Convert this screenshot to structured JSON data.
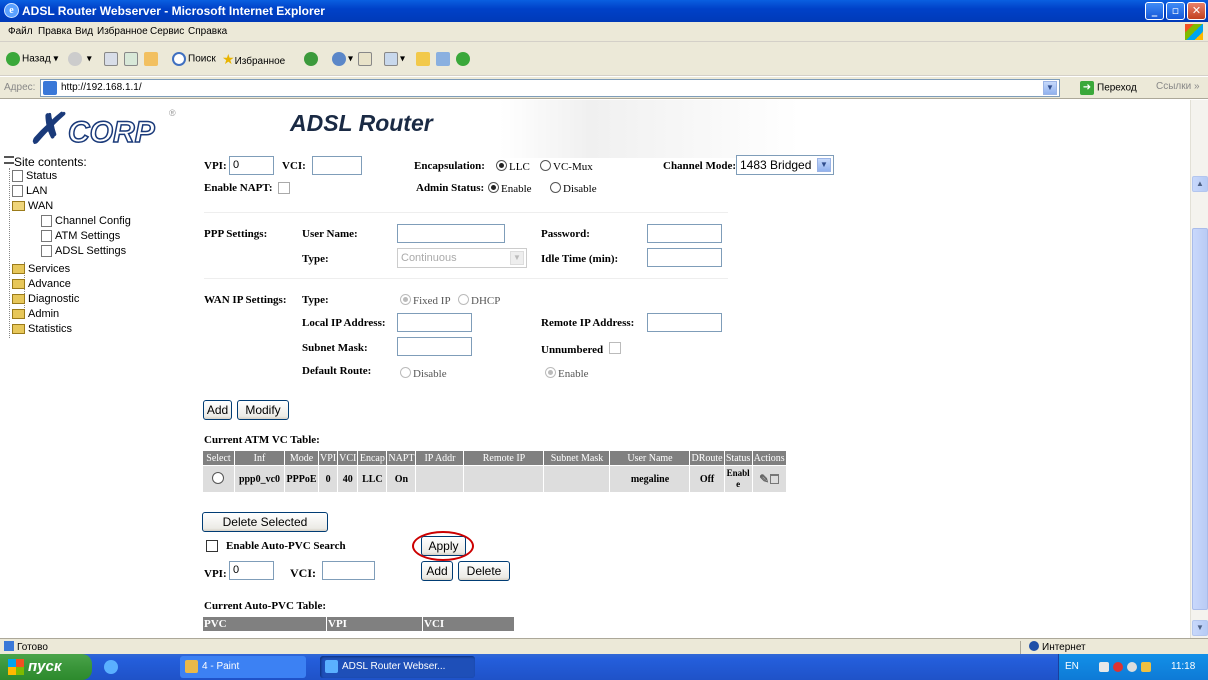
{
  "window": {
    "title": "ADSL Router Webserver - Microsoft Internet Explorer"
  },
  "menu": [
    "Файл",
    "Правка",
    "Вид",
    "Избранное",
    "Сервис",
    "Справка"
  ],
  "toolbar": {
    "back": "Назад",
    "search": "Поиск",
    "favorites": "Избранное"
  },
  "address": {
    "label": "Адрес:",
    "url": "http://192.168.1.1/",
    "go": "Переход",
    "links": "Ссылки"
  },
  "page": {
    "brand": "CORP",
    "heading": "ADSL Router",
    "sidebar": {
      "title": "Site contents:",
      "items": [
        "Status",
        "LAN",
        "WAN",
        "Channel Config",
        "ATM Settings",
        "ADSL Settings",
        "Services",
        "Advance",
        "Diagnostic",
        "Admin",
        "Statistics"
      ]
    },
    "form": {
      "vpi_label": "VPI:",
      "vpi": "0",
      "vci_label": "VCI:",
      "vci": "",
      "encap_label": "Encapsulation:",
      "encap_llc": "LLC",
      "encap_vcmux": "VC-Mux",
      "channel_mode_label": "Channel Mode:",
      "channel_mode": "1483 Bridged",
      "napt_label": "Enable NAPT:",
      "admin_label": "Admin Status:",
      "admin_enable": "Enable",
      "admin_disable": "Disable",
      "ppp_label": "PPP Settings:",
      "username_label": "User Name:",
      "password_label": "Password:",
      "type_label": "Type:",
      "type_value": "Continuous",
      "idle_label": "Idle Time (min):",
      "wanip_label": "WAN IP Settings:",
      "wan_type_label": "Type:",
      "fixed_ip": "Fixed IP",
      "dhcp": "DHCP",
      "local_ip_label": "Local IP Address:",
      "remote_ip_label": "Remote IP Address:",
      "subnet_label": "Subnet Mask:",
      "unnumbered_label": "Unnumbered",
      "default_route_label": "Default Route:",
      "dr_disable": "Disable",
      "dr_enable": "Enable",
      "add": "Add",
      "modify": "Modify"
    },
    "vc_table": {
      "title": "Current ATM VC Table:",
      "headers": [
        "Select",
        "Inf",
        "Mode",
        "VPI",
        "VCI",
        "Encap",
        "NAPT",
        "IP Addr",
        "Remote IP",
        "Subnet Mask",
        "User Name",
        "DRoute",
        "Status",
        "Actions"
      ],
      "rows": [
        {
          "inf": "ppp0_vc0",
          "mode": "PPPoE",
          "vpi": "0",
          "vci": "40",
          "encap": "LLC",
          "napt": "On",
          "ip": "",
          "remote": "",
          "mask": "",
          "user": "megaline",
          "droute": "Off",
          "status": "Enabl e"
        }
      ]
    },
    "delete_selected": "Delete Selected",
    "auto_pvc": {
      "enable_label": "Enable Auto-PVC Search",
      "apply": "Apply",
      "vpi_label": "VPI:",
      "vpi": "0",
      "vci_label": "VCI:",
      "vci": "",
      "add": "Add",
      "delete": "Delete",
      "table_title": "Current Auto-PVC Table:",
      "headers": [
        "PVC",
        "VPI",
        "VCI"
      ]
    }
  },
  "status": {
    "left": "Готово",
    "zone": "Интернет"
  },
  "taskbar": {
    "start": "пуск",
    "tasks": [
      "4 - Paint",
      "ADSL Router Webser..."
    ],
    "lang": "EN",
    "clock": "11:18"
  }
}
